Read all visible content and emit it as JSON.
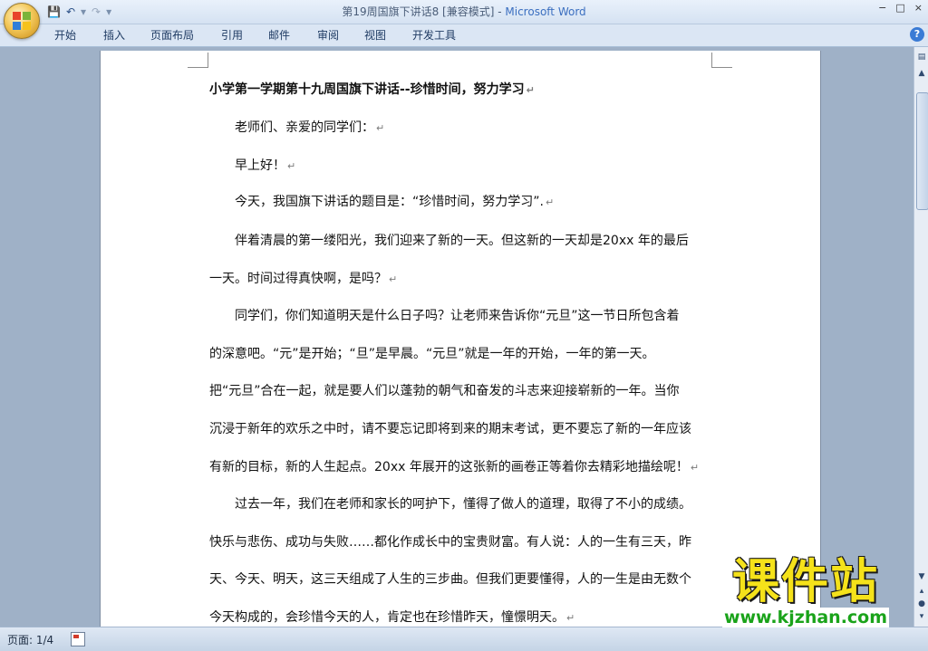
{
  "window": {
    "title": "第19周国旗下讲话8 [兼容模式]",
    "title_sep": " - ",
    "app_name": "Microsoft Word",
    "controls": [
      "−",
      "□",
      "×"
    ]
  },
  "quick_access": {
    "save_icon": "save-icon",
    "undo_icon": "undo-icon",
    "redo_icon": "redo-icon"
  },
  "ribbon": {
    "tabs": [
      "开始",
      "插入",
      "页面布局",
      "引用",
      "邮件",
      "审阅",
      "视图",
      "开发工具"
    ],
    "help": "?"
  },
  "document": {
    "title": "小学第一学期第十九周国旗下讲话--珍惜时间，努力学习",
    "lines": [
      "老师们、亲爱的同学们：",
      "早上好！",
      "今天，我国旗下讲话的题目是：“珍惜时间，努力学习”.",
      "伴着清晨的第一缕阳光，我们迎来了新的一天。但这新的一天却是20xx 年的最后",
      "一天。时间过得真快啊，是吗？",
      "同学们，你们知道明天是什么日子吗？让老师来告诉你“元旦”这一节日所包含着",
      "的深意吧。“元”是开始；“旦”是早晨。“元旦”就是一年的开始，一年的第一天。",
      "把“元旦”合在一起，就是要人们以蓬勃的朝气和奋发的斗志来迎接崭新的一年。当你",
      "沉浸于新年的欢乐之中时，请不要忘记即将到来的期末考试，更不要忘了新的一年应该",
      "有新的目标，新的人生起点。20xx 年展开的这张新的画卷正等着你去精彩地描绘呢！",
      "过去一年，我们在老师和家长的呵护下，懂得了做人的道理，取得了不小的成绩。",
      "快乐与悲伤、成功与失败……都化作成长中的宝贵财富。有人说：人的一生有三天，昨",
      "天、今天、明天，这三天组成了人生的三步曲。但我们更要懂得，人的一生是由无数个",
      "今天构成的，会珍惜今天的人，肯定也在珍惜昨天，憧憬明天。"
    ],
    "paragraph_mark": "↵"
  },
  "status": {
    "page": "页面: 1/4"
  },
  "watermark": {
    "cn": "课件站",
    "url": "www.kjzhan.com"
  }
}
